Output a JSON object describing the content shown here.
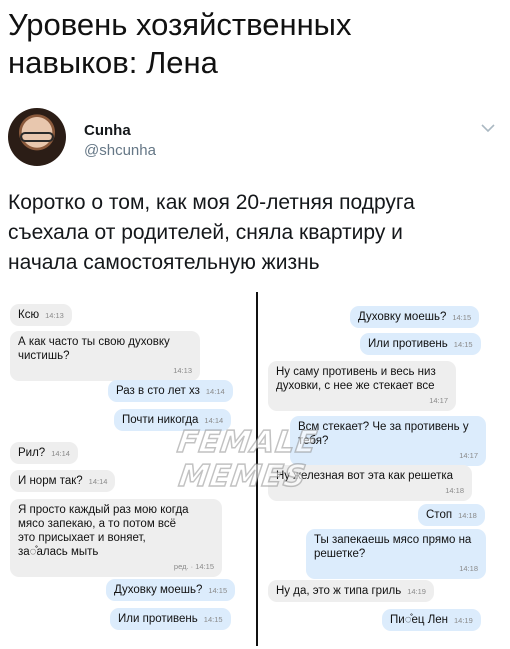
{
  "headline": "Уровень хозяйственных\nнавыков: Лена",
  "tweet": {
    "display_name": "Cunha",
    "handle": "@shcunha",
    "text": "Коротко о том, как моя 20-летняя подруга\nсъехала от родителей, сняла квартиру и\nначала самостоятельную жизнь",
    "avatar_icon": "profile-photo",
    "menu_icon": "chevron-down-icon"
  },
  "watermark": {
    "line1": "FEMALE",
    "line2": "MEMES"
  },
  "colors": {
    "incoming": "#eeeeee",
    "outgoing": "#dcecfc",
    "divider": "#111111"
  },
  "chat_left": [
    {
      "side": "in",
      "text": "Ксю",
      "time": "14:13"
    },
    {
      "side": "in",
      "text": "А как часто ты свою духовку\nчистишь?",
      "time": "14:13"
    },
    {
      "side": "out",
      "text": "Раз в сто лет хз",
      "time": "14:14"
    },
    {
      "side": "out",
      "text": "Почти никогда",
      "time": "14:14"
    },
    {
      "side": "in",
      "text": "Рил?",
      "time": "14:14"
    },
    {
      "side": "in",
      "text": "И норм так?",
      "time": "14:14"
    },
    {
      "side": "in",
      "text": "Я просто каждый раз мою когда\nмясо запекаю, а то потом всё\nэто присыхает и воняет,\nза◌̊алась мыть",
      "time": "ред. · 14:15"
    },
    {
      "side": "out",
      "text": "Духовку моешь?",
      "time": "14:15"
    },
    {
      "side": "out",
      "text": "Или противень",
      "time": "14:15"
    }
  ],
  "chat_right": [
    {
      "side": "out",
      "text": "Духовку моешь?",
      "time": "14:15"
    },
    {
      "side": "out",
      "text": "Или противень",
      "time": "14:15"
    },
    {
      "side": "in",
      "text": "Ну саму противень и весь низ\nдуховки, с нее же стекает все",
      "time": "14:17"
    },
    {
      "side": "out",
      "text": "Всм стекает? Че за противень у\nтебя?",
      "time": "14:17"
    },
    {
      "side": "in",
      "text": "Ну железная вот эта как решетка",
      "time": "14:18"
    },
    {
      "side": "out",
      "text": "Стоп",
      "time": "14:18"
    },
    {
      "side": "out",
      "text": "Ты запекаешь мясо прямо на\nрешетке?",
      "time": "14:18"
    },
    {
      "side": "in",
      "text": "Ну да, это ж типа гриль",
      "time": "14:19"
    },
    {
      "side": "out",
      "text": "Пи◌̊ец Лен",
      "time": "14:19"
    }
  ]
}
